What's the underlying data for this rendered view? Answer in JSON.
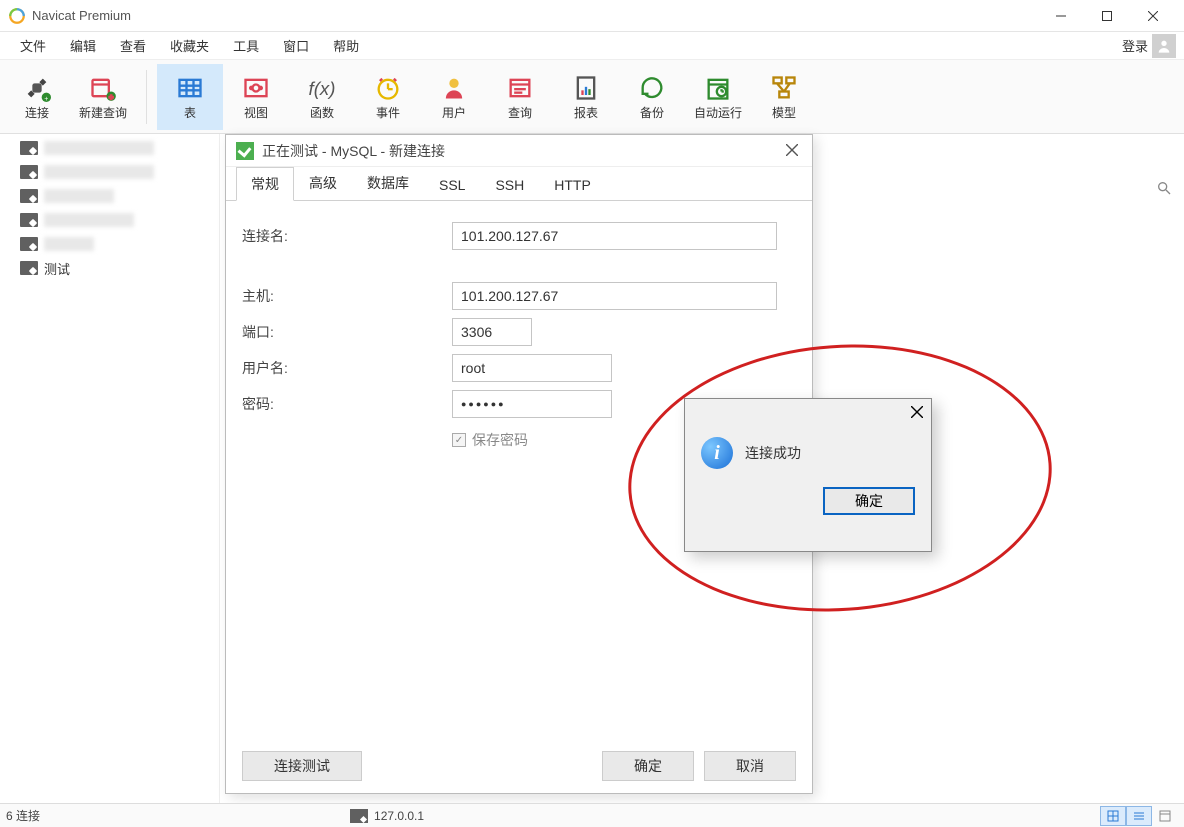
{
  "window": {
    "title": "Navicat Premium"
  },
  "menubar": {
    "items": [
      "文件",
      "编辑",
      "查看",
      "收藏夹",
      "工具",
      "窗口",
      "帮助"
    ],
    "login": "登录"
  },
  "toolbar": {
    "connect": "连接",
    "newquery": "新建查询",
    "table": "表",
    "view": "视图",
    "function": "函数",
    "event": "事件",
    "user": "用户",
    "query": "查询",
    "report": "报表",
    "backup": "备份",
    "schedule": "自动运行",
    "model": "模型"
  },
  "sidebar": {
    "test_label": "测试"
  },
  "dialog": {
    "title": "正在测试 - MySQL - 新建连接",
    "tabs": [
      "常规",
      "高级",
      "数据库",
      "SSL",
      "SSH",
      "HTTP"
    ],
    "labels": {
      "conn_name": "连接名:",
      "host": "主机:",
      "port": "端口:",
      "user": "用户名:",
      "password": "密码:",
      "save_pw": "保存密码"
    },
    "values": {
      "conn_name": "101.200.127.67",
      "host": "101.200.127.67",
      "port": "3306",
      "user": "root",
      "password": "●●●●●●"
    },
    "buttons": {
      "test": "连接测试",
      "ok": "确定",
      "cancel": "取消"
    }
  },
  "msgbox": {
    "text": "连接成功",
    "ok": "确定"
  },
  "status": {
    "conns": "6 连接",
    "ip": "127.0.0.1"
  }
}
